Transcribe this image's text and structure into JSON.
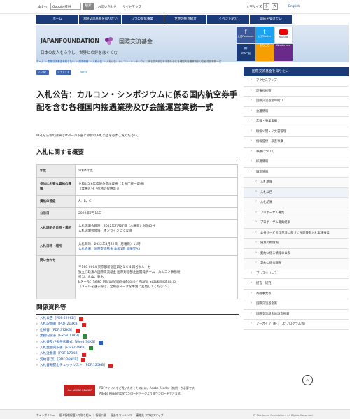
{
  "top": {
    "site_links": [
      "本文へ",
      "お問い合わせ",
      "サイトマップ"
    ],
    "search_placeholder": "Google 提供",
    "search_button": "検索",
    "font_size_label": "文字サイズ",
    "font_small": "小",
    "font_large": "大",
    "english": "English"
  },
  "nav": [
    "ホーム",
    "国際交流基金を知りたい",
    "3つの文化事業",
    "世界の拠点紹介",
    "イベント紹介",
    "助成を受けたい"
  ],
  "banner": {
    "logo": "JAPANFOUNDATION",
    "logo_jp": "国際交流基金",
    "tagline": "日本の友人をふやし、世界との絆をはぐくむ",
    "social": [
      "公式Facebook",
      "公式Twitter",
      "YouTube",
      "SNS一覧",
      "をちこち",
      "What's new"
    ]
  },
  "breadcrumb": [
    "ホーム",
    "国際交流基金を知りたい",
    "調達情報",
    "入札公告",
    "入札公告：カルコン・シンポジウムに係る国内航空券手配を含む各種国内接遇業務及び会議運営業務一式"
  ],
  "share": {
    "like": "いいね！",
    "share": "シェアする",
    "tweet": "Tweet"
  },
  "page_title": "入札公告：カルコン・シンポジウムに係る国内航空券手配を含む各種国内接遇業務及び会議運営業務一式",
  "intro": "申込方法等の詳細は本ページ下部に添付の入札公告を必ずご覧ください。",
  "section1_title": "入札に関する概要",
  "table": [
    {
      "label": "年度",
      "value": [
        "令和4年度"
      ]
    },
    {
      "label": "参加に必要な資格の種類",
      "value": [
        "令和4,5,6年度競争参加資格（全省庁統一資格）",
        "（業種区分「役務の提供等」）"
      ]
    },
    {
      "label": "資格の等級",
      "value": [
        "A、B、C"
      ]
    },
    {
      "label": "公示日",
      "value": [
        "2022年7月15日"
      ]
    },
    {
      "label": "入札説明会日時・場所",
      "value": [
        "入札説明会日時：2022年7月27日（水曜日）9時45分",
        "入札説明会会場：オンラインにて実施"
      ]
    },
    {
      "label": "入札日時・場所",
      "value": [
        "入札日時：2022年8月22日（月曜日）11時",
        "入札会場：国際交流基金 本部1階 会議室A3"
      ]
    },
    {
      "label": "問い合わせ",
      "value": [
        "〒160-0004 東京都新宿区四谷1-6-4 四谷クルーセ",
        "独立行政法人国際交流基金 国際対話部企画開発チーム　カルコン事務局",
        "担当：丸山、鈴木",
        "Eメール：Seiko_Maruyama@jpf.go.jp／Miami_Suzuki@jpf.go.jp",
        "（メールを送る際は、全角@マークを半角に変更してください。）"
      ]
    }
  ],
  "section2_title": "関係資料等",
  "documents": [
    {
      "text": "入札公告［PDF:329KB］",
      "type": "pdf"
    },
    {
      "text": "入札説明書［PDF:213KB］",
      "type": "pdf"
    },
    {
      "text": "仕様書［PDF:372KB］",
      "type": "pdf"
    },
    {
      "text": "業務内訳表［Excel:11KB］",
      "type": "xls"
    },
    {
      "text": "入札書及び委任状書式［Word:34KB］",
      "type": "doc"
    },
    {
      "text": "入札金額内訳書［Excel:26KB］",
      "type": "xls"
    },
    {
      "text": "入札注意書［PDF:173KB］",
      "type": "pdf"
    },
    {
      "text": "契約書(案)［PDF:269KB］",
      "type": "pdf"
    },
    {
      "text": "入札書類提出チェックリスト［PDF:125KB］",
      "type": "pdf"
    }
  ],
  "reader": {
    "badge": "Get ADOBE READER",
    "line1": "PDFファイルをご覧いただくためには、Adobe Reader（無償）が必要です。",
    "line2": "Adobe Readerはダウンロードページよりダウンロードできます。"
  },
  "sidebar": {
    "head": "国際交流基金を知りたい",
    "items": [
      {
        "text": "アクセスマップ",
        "sub": false
      },
      {
        "text": "理事長挨拶",
        "sub": false
      },
      {
        "text": "国際交流基金の紹介",
        "sub": false
      },
      {
        "text": "会議情報",
        "sub": false
      },
      {
        "text": "年報・事業実績",
        "sub": false
      },
      {
        "text": "情報公開・公文書管理",
        "sub": false
      },
      {
        "text": "情報提供・調査事業",
        "sub": false
      },
      {
        "text": "事故について",
        "sub": false
      },
      {
        "text": "採用情報",
        "sub": false
      },
      {
        "text": "調達情報",
        "sub": false
      },
      {
        "text": "入札情報",
        "sub": true
      },
      {
        "text": "入札公告",
        "sub": true
      },
      {
        "text": "入札結果",
        "sub": true
      },
      {
        "text": "プロポーザル募集",
        "sub": true
      },
      {
        "text": "プロポーザル募集結果",
        "sub": true
      },
      {
        "text": "公共サービス改革法に基づく民間競争入札実施事業",
        "sub": true
      },
      {
        "text": "随意契約情報",
        "sub": true
      },
      {
        "text": "契約に係る情報の公表",
        "sub": true
      },
      {
        "text": "契約に係る調査",
        "sub": true
      },
      {
        "text": "プレスリリース",
        "sub": false
      },
      {
        "text": "提言・研究",
        "sub": false
      },
      {
        "text": "寄附事業等",
        "sub": false
      },
      {
        "text": "国際交流基金賞",
        "sub": false
      },
      {
        "text": "国際交流基金地球市民賞",
        "sub": false
      },
      {
        "text": "アーカイブ（終了したプログラム等）",
        "sub": false
      }
    ]
  },
  "footer": {
    "links": "サイトポリシー ｜ 個人情報保護への取り組み ｜ 情報公開 ｜ 過去のコンテンツ ｜ 連絡先 アクセスマップ",
    "copyright": "© The Japan Foundation, All Rights Reserved."
  },
  "colors": {
    "navy": "#1a3b78",
    "link": "#1a4fa0",
    "pdf": "#d22222"
  }
}
